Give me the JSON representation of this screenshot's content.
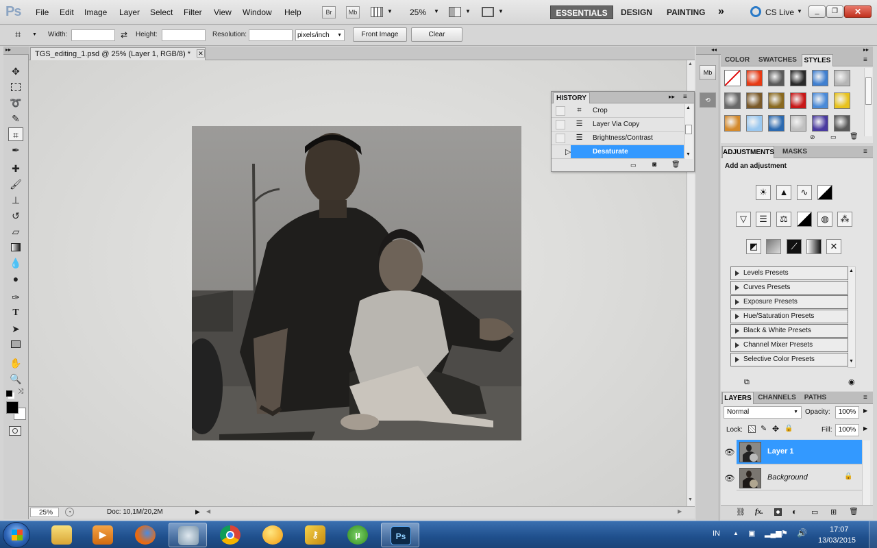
{
  "app": {
    "logo": "Ps"
  },
  "menubar": {
    "items": [
      "File",
      "Edit",
      "Image",
      "Layer",
      "Select",
      "Filter",
      "View",
      "Window",
      "Help"
    ],
    "bridge_label": "Br",
    "minibridge_label": "Mb",
    "zoom": "25%",
    "workspaces": {
      "active": "ESSENTIALS",
      "others": [
        "DESIGN",
        "PAINTING"
      ]
    },
    "more_icon": "double-chevron-right",
    "cs_live": "CS Live"
  },
  "options_bar": {
    "width_label": "Width:",
    "height_label": "Height:",
    "resolution_label": "Resolution:",
    "units": "pixels/inch",
    "front_image": "Front Image",
    "clear": "Clear"
  },
  "document": {
    "tab_title": "TGS_editing_1.psd @ 25% (Layer 1, RGB/8) *",
    "status_zoom": "25%",
    "status_doc": "Doc: 10,1M/20,2M"
  },
  "history": {
    "title": "HISTORY",
    "items": [
      {
        "label": "Crop",
        "icon": "crop-icon"
      },
      {
        "label": "Layer Via Copy",
        "icon": "history-step-icon"
      },
      {
        "label": "Brightness/Contrast",
        "icon": "history-step-icon"
      },
      {
        "label": "Desaturate",
        "icon": "history-step-icon",
        "selected": true
      }
    ]
  },
  "styles_panel": {
    "tabs": [
      "COLOR",
      "SWATCHES",
      "STYLES"
    ],
    "active_tab": "STYLES",
    "swatches": [
      "#ffffff",
      "#e83a14",
      "#5a5a5a",
      "#2a2a2a",
      "#3f7fd0",
      "#b5b5b5",
      "#6a6a6a",
      "#7a5a2a",
      "#8a6a20",
      "#c81818",
      "#4a8ad8",
      "#e8c21c",
      "#d48a2c",
      "#9ac8f0",
      "#2c6ab0",
      "#c0c0c0",
      "#4a3aa0",
      "#5a5a5a"
    ]
  },
  "adjustments": {
    "tabs": [
      "ADJUSTMENTS",
      "MASKS"
    ],
    "active_tab": "ADJUSTMENTS",
    "heading": "Add an adjustment",
    "presets": [
      "Levels Presets",
      "Curves Presets",
      "Exposure Presets",
      "Hue/Saturation Presets",
      "Black & White Presets",
      "Channel Mixer Presets",
      "Selective Color Presets"
    ]
  },
  "layers": {
    "tabs": [
      "LAYERS",
      "CHANNELS",
      "PATHS"
    ],
    "active_tab": "LAYERS",
    "blend_mode": "Normal",
    "opacity_label": "Opacity:",
    "opacity": "100%",
    "lock_label": "Lock:",
    "fill_label": "Fill:",
    "fill": "100%",
    "items": [
      {
        "name": "Layer 1",
        "selected": true
      },
      {
        "name": "Background",
        "locked": true
      }
    ]
  },
  "taskbar": {
    "apps": [
      "start",
      "explorer",
      "media-player",
      "firefox",
      "search-app",
      "chrome",
      "messenger",
      "tool",
      "utorrent",
      "photoshop"
    ],
    "active": "photoshop",
    "language": "IN",
    "time": "17:07",
    "date": "13/03/2015"
  },
  "colors": {
    "accent": "#3399ff",
    "selection": "#4aa0f0"
  }
}
